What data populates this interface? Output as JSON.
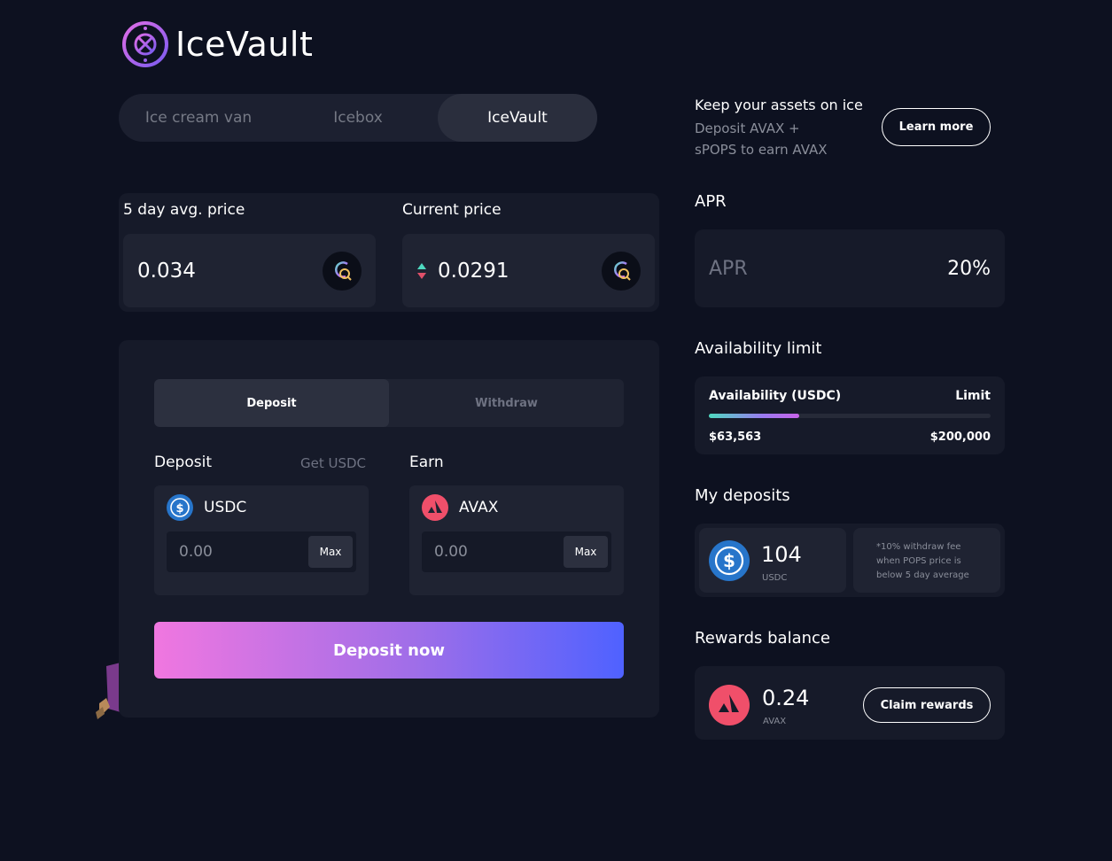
{
  "app": {
    "name": "IceVault"
  },
  "tabs": [
    {
      "label": "Ice cream van",
      "active": false
    },
    {
      "label": "Icebox",
      "active": false
    },
    {
      "label": "IceVault",
      "active": true
    }
  ],
  "prices": {
    "avg_label": "5 day avg. price",
    "avg_value": "0.034",
    "current_label": "Current price",
    "current_value": "0.0291"
  },
  "deposit_panel": {
    "tabs": [
      {
        "label": "Deposit",
        "active": true
      },
      {
        "label": "Withdraw",
        "active": false
      }
    ],
    "deposit_label": "Deposit",
    "get_usdc": "Get USDC",
    "earn_label": "Earn",
    "deposit_asset": "USDC",
    "earn_asset": "AVAX",
    "deposit_placeholder": "0.00",
    "earn_placeholder": "0.00",
    "max_label": "Max",
    "submit_label": "Deposit now"
  },
  "promo": {
    "title": "Keep your assets on ice",
    "subtitle_line1": "Deposit AVAX +",
    "subtitle_line2": "sPOPS to earn AVAX",
    "learn_more": "Learn more"
  },
  "apr": {
    "heading": "APR",
    "label": "APR",
    "value": "20%"
  },
  "availability": {
    "heading": "Availability limit",
    "label": "Availability (USDC)",
    "limit_label": "Limit",
    "current": "$63,563",
    "limit": "$200,000",
    "fill_fraction": 0.32
  },
  "my_deposits": {
    "heading": "My deposits",
    "amount": "104",
    "unit": "USDC",
    "fee_note_line1": "*10% withdraw fee",
    "fee_note_line2": "when POPS price is",
    "fee_note_line3": "below 5 day average"
  },
  "rewards": {
    "heading": "Rewards balance",
    "amount": "0.24",
    "unit": "AVAX",
    "claim_label": "Claim rewards"
  },
  "colors": {
    "background": "#0d1120",
    "panel": "#161a29",
    "usdc_blue": "#2775ca",
    "avax_red": "#e84142",
    "accent_start": "#f077e0",
    "accent_end": "#4f62ff"
  },
  "icons": [
    "logo-mark-icon",
    "pops-coin-icon",
    "price-arrows-icon",
    "usdc-icon",
    "avax-icon",
    "popsicle-illustration"
  ]
}
